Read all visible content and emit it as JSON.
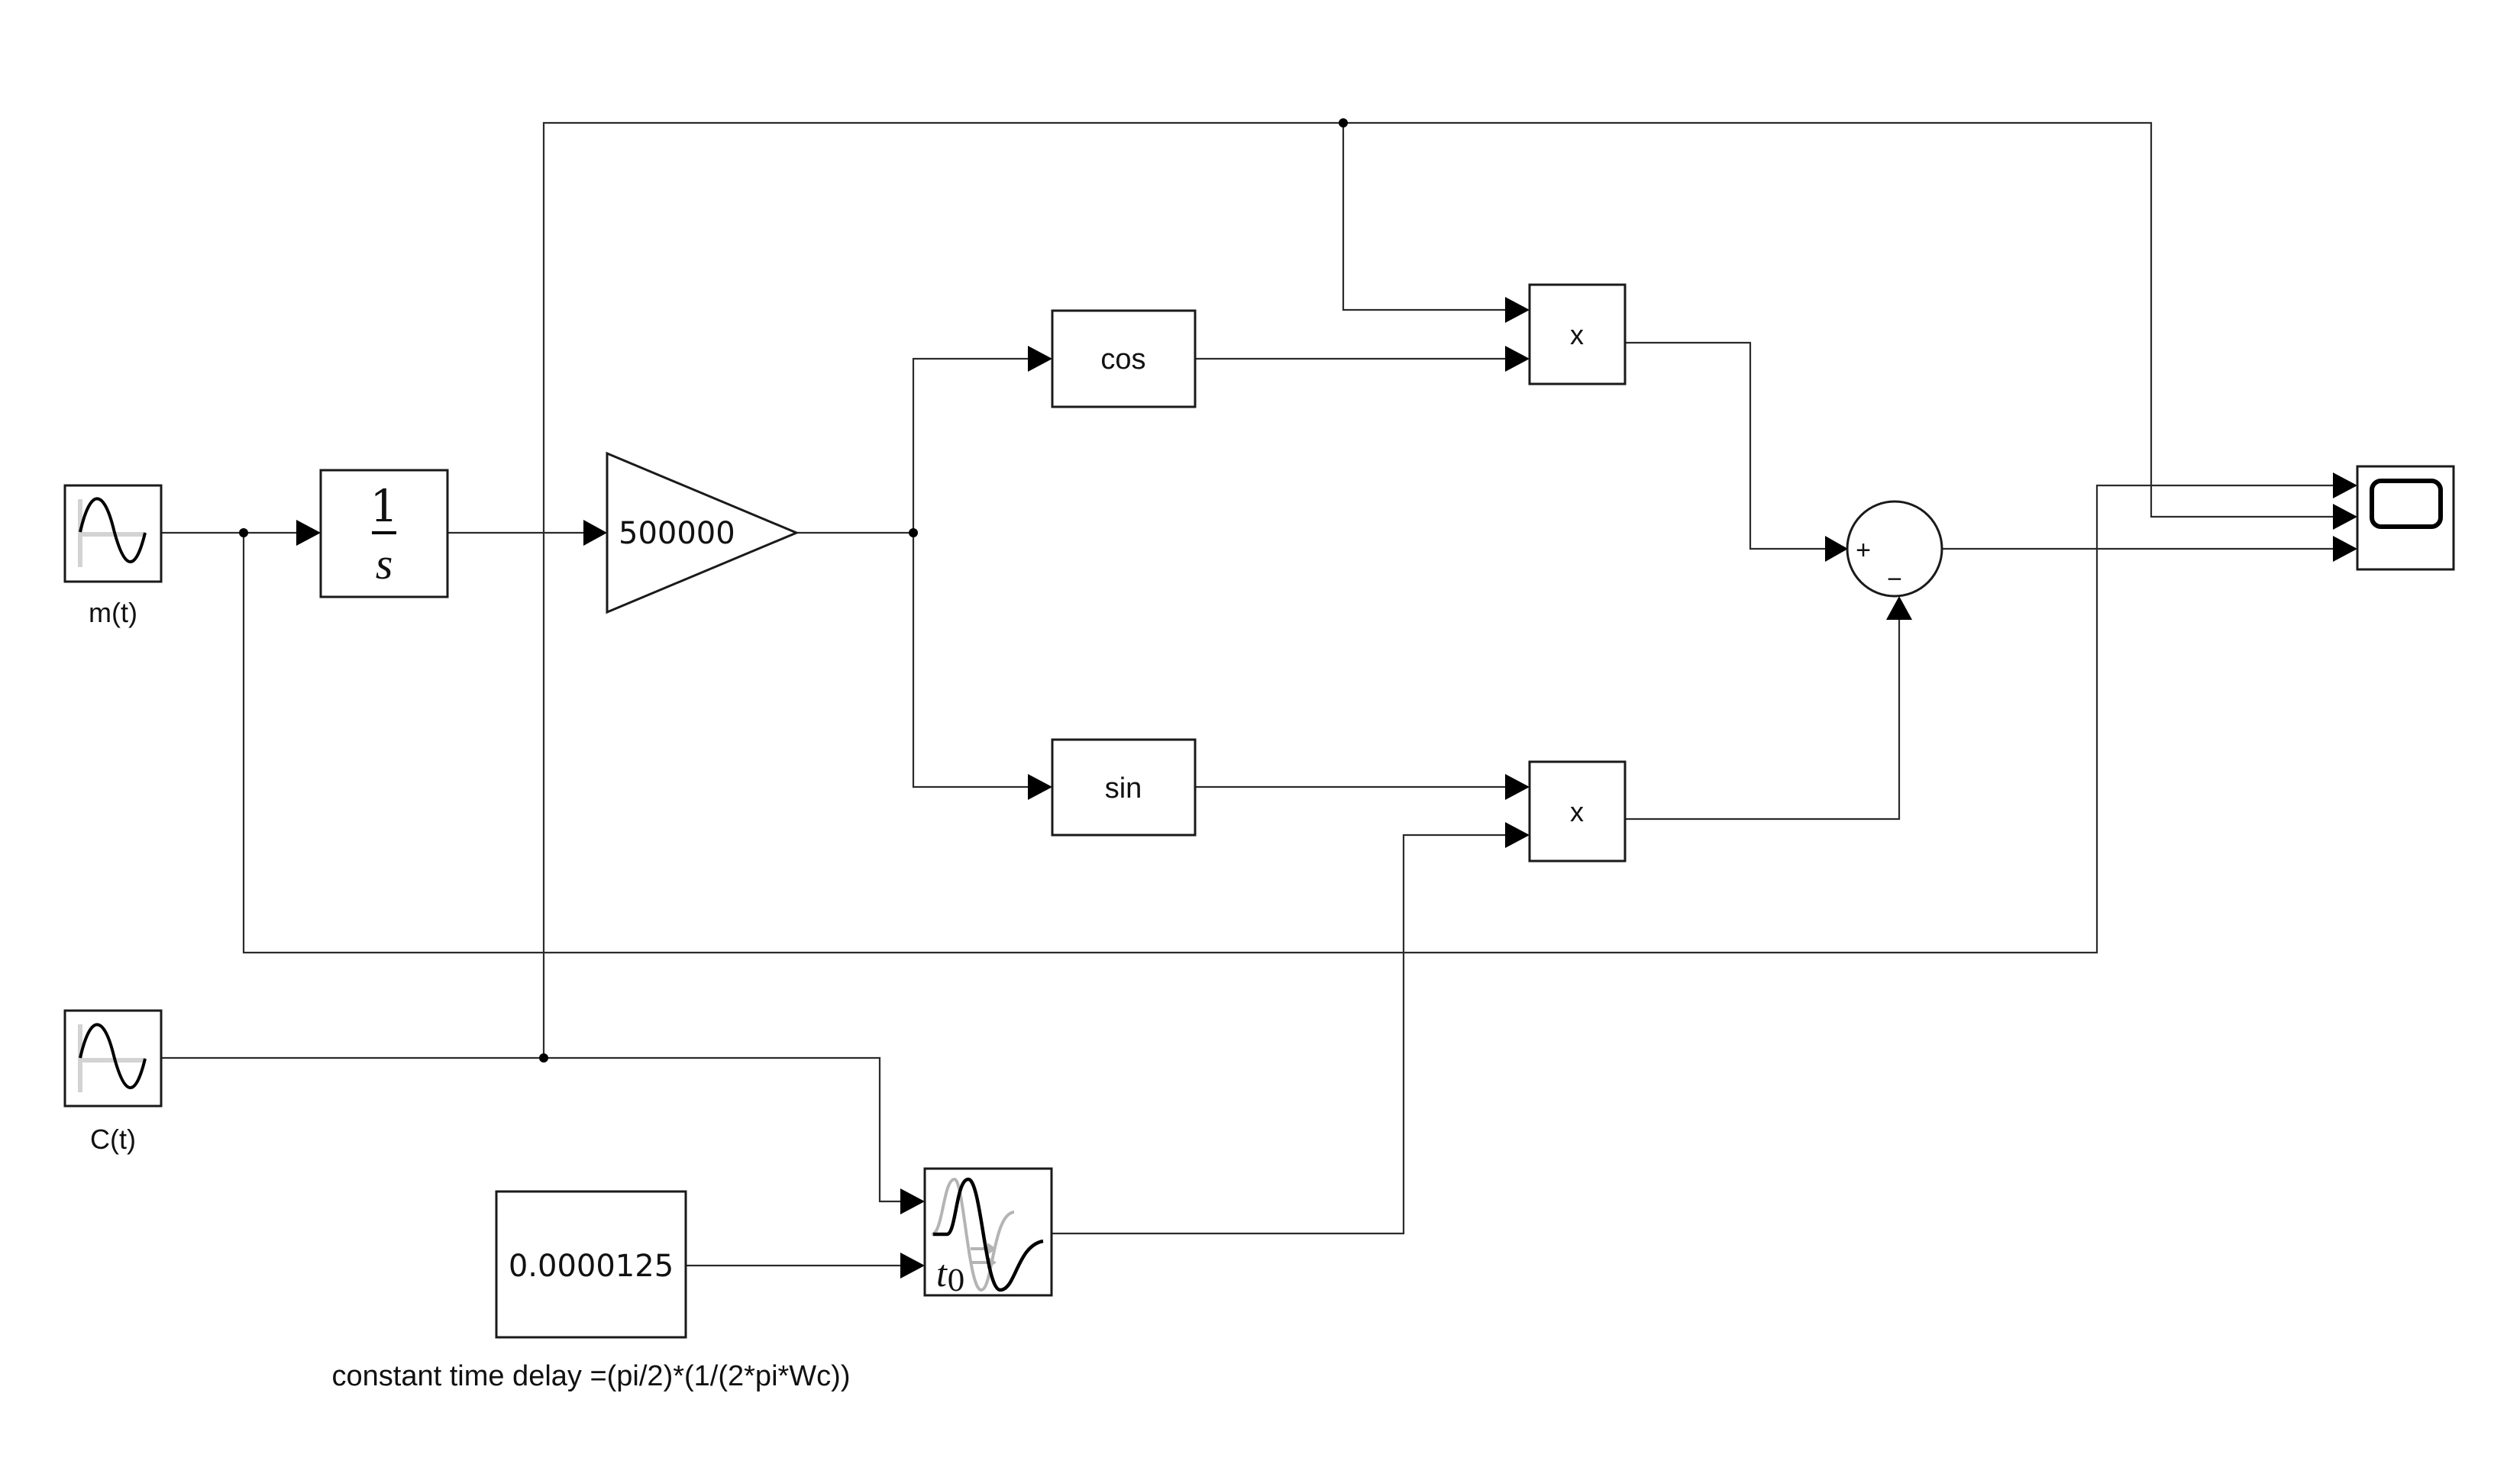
{
  "diagram": {
    "kind": "Simulink block diagram (FM modulator, phase-shift method)",
    "blocks": {
      "source_m": {
        "type": "Sine Wave",
        "label": "m(t)",
        "icon": "sine-wave-icon"
      },
      "source_c": {
        "type": "Sine Wave",
        "label": "C(t)",
        "icon": "sine-wave-icon"
      },
      "integrator": {
        "type": "Integrator",
        "numerator": "1",
        "denominator": "s"
      },
      "gain": {
        "type": "Gain",
        "value": "500000"
      },
      "cos_fn": {
        "type": "Trigonometric Function",
        "text": "cos"
      },
      "sin_fn": {
        "type": "Trigonometric Function",
        "text": "sin"
      },
      "product_top": {
        "type": "Product",
        "text": "x"
      },
      "product_bottom": {
        "type": "Product",
        "text": "x"
      },
      "sum": {
        "type": "Sum",
        "signs": [
          "+",
          "−"
        ]
      },
      "constant": {
        "type": "Constant",
        "value": "0.0000125",
        "label": "constant time delay =(pi/2)*(1/(2*pi*Wc))"
      },
      "variable_delay": {
        "type": "Variable Time Delay",
        "text": "t",
        "subscript": "0",
        "icon": "time-delay-icon"
      },
      "scope": {
        "type": "Scope",
        "icon": "scope-screen-icon",
        "inputs": 3
      }
    }
  }
}
